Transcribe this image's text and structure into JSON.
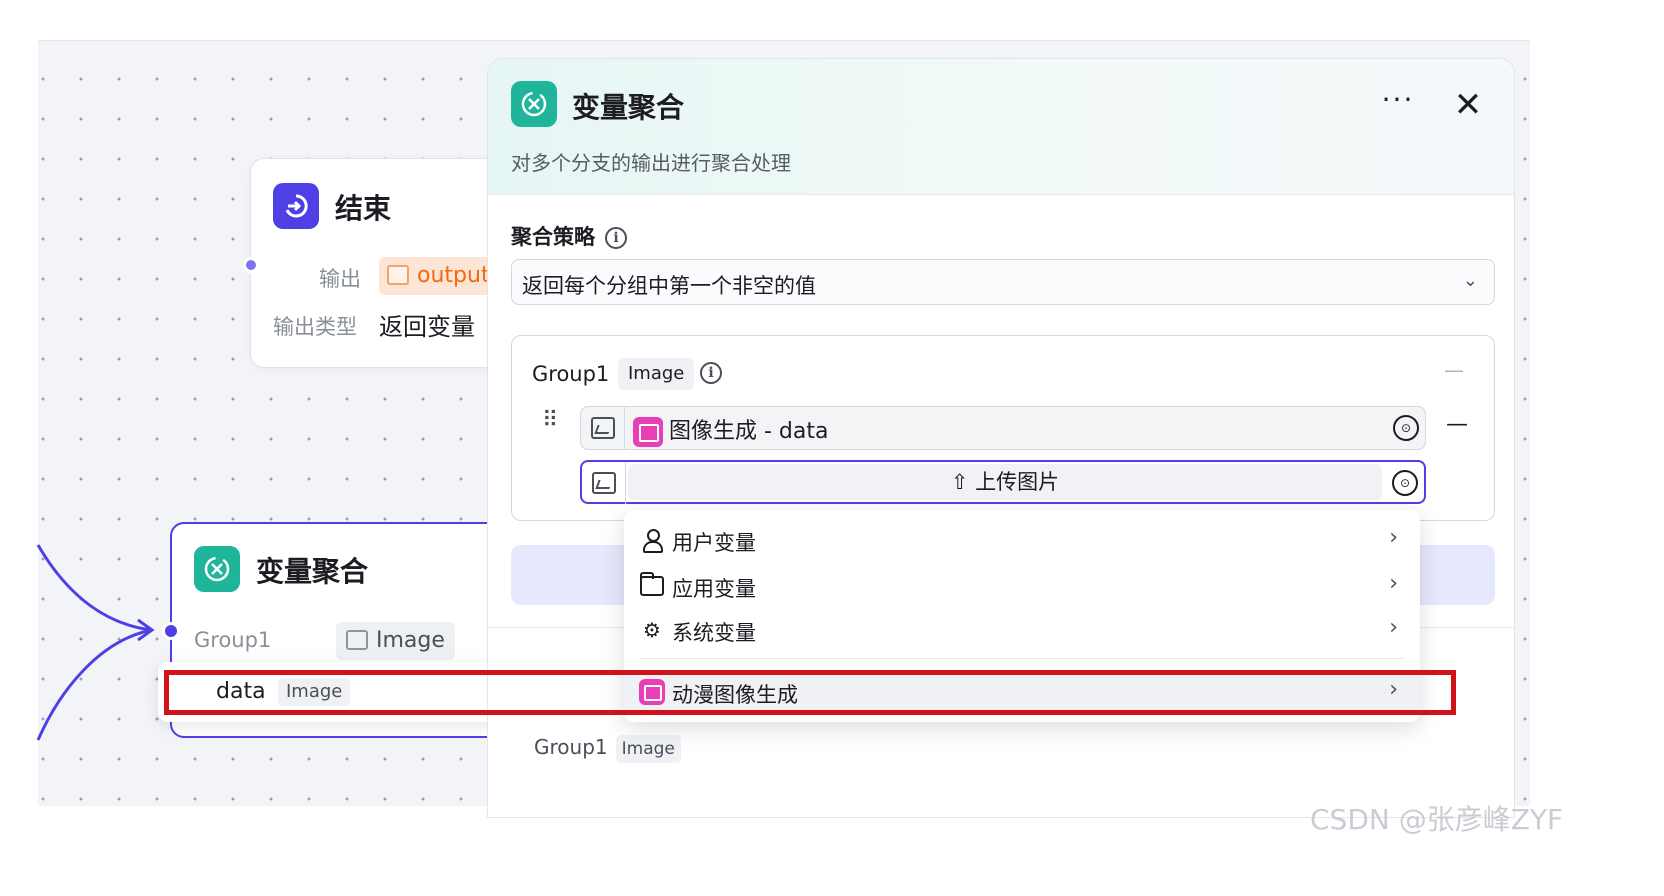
{
  "canvas": {
    "end_node": {
      "title": "结束",
      "output_label": "输出",
      "output_tag": "output",
      "output_type_label": "输出类型",
      "output_type_value": "返回变量"
    },
    "agg_node": {
      "title": "变量聚合",
      "group_label": "Group1",
      "group_type": "Image",
      "data_name": "data",
      "data_type": "Image"
    }
  },
  "panel": {
    "title": "变量聚合",
    "description": "对多个分支的输出进行聚合处理",
    "more_glyph": "···",
    "close_glyph": "✕",
    "strategy": {
      "label": "聚合策略",
      "value": "返回每个分组中第一个非空的值"
    },
    "group": {
      "name": "Group1",
      "type": "Image",
      "collapse_glyph": "—",
      "rows": [
        {
          "ref": "图像生成 - data"
        },
        {
          "upload_label": "上传图片"
        }
      ],
      "remove_glyph": "—"
    },
    "output_preview": {
      "name": "Group1",
      "type": "Image"
    }
  },
  "menu": {
    "items": [
      {
        "label": "用户变量",
        "icon": "user-icon"
      },
      {
        "label": "应用变量",
        "icon": "folder-icon"
      },
      {
        "label": "系统变量",
        "icon": "gear-icon"
      },
      {
        "label": "动漫图像生成",
        "icon": "image-gen-icon"
      }
    ]
  },
  "watermark": "CSDN @张彦峰ZYF",
  "colors": {
    "accent": "#4e40e5",
    "agg_icon": "#1eb59a",
    "image_gen": "#e83fb8",
    "highlight_box": "#d0121b",
    "output_tag": "#f06a0f"
  }
}
